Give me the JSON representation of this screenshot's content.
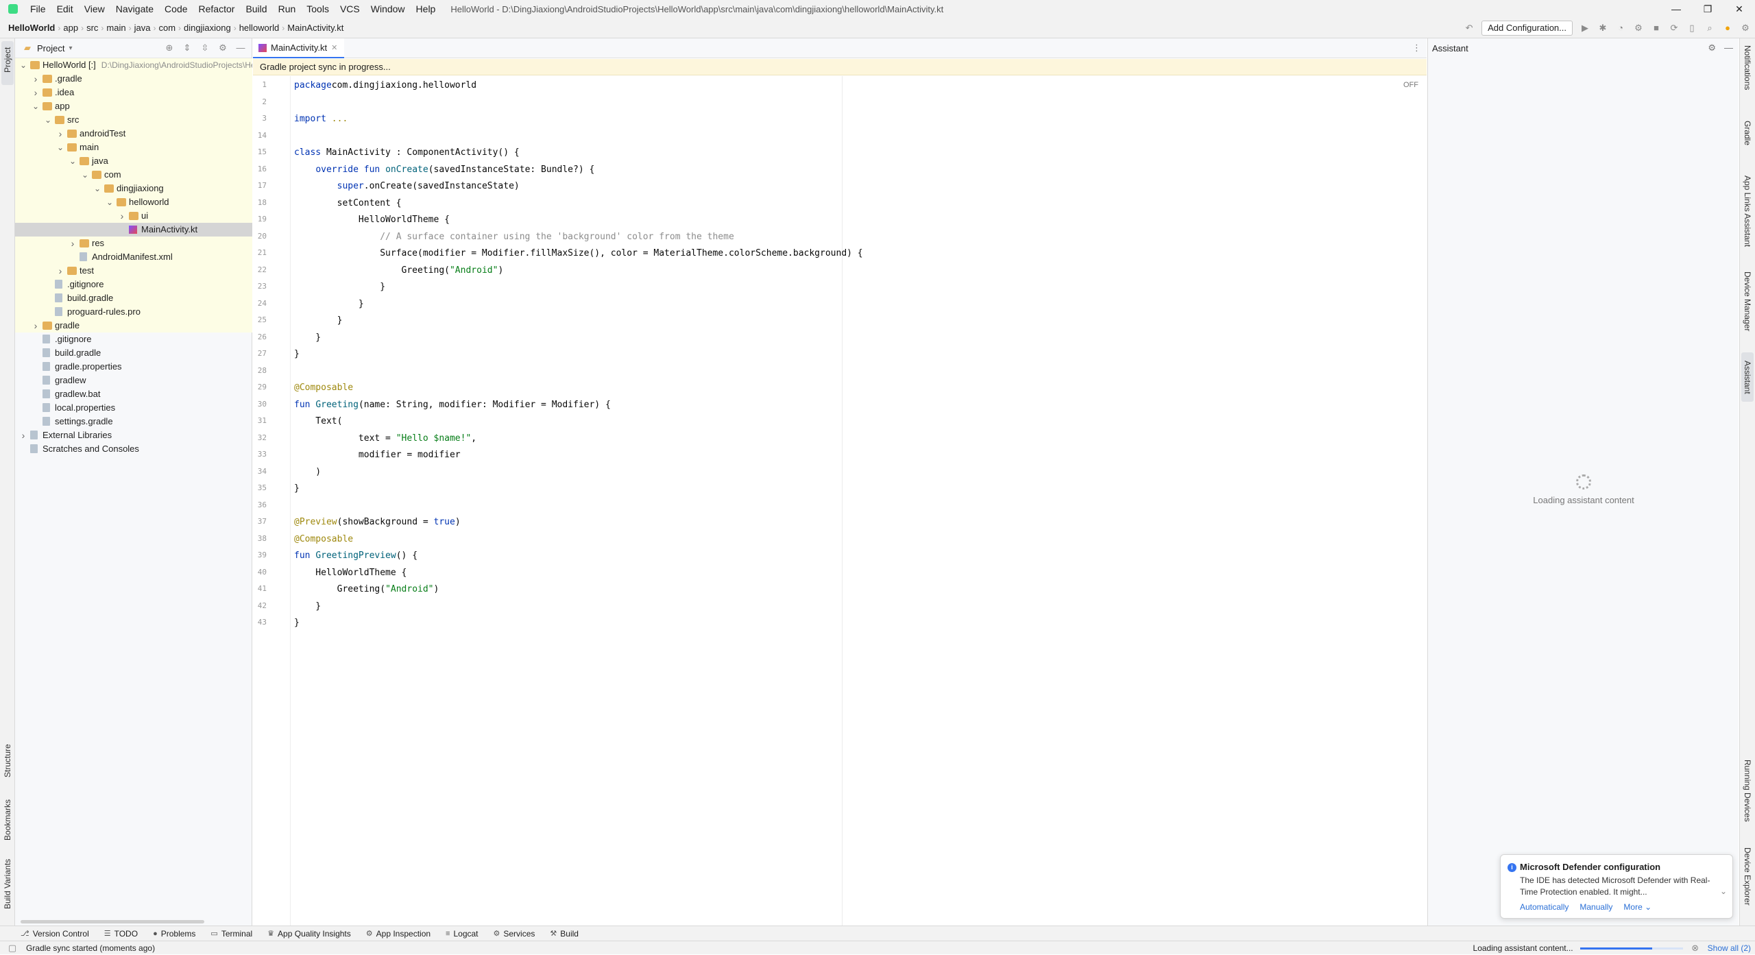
{
  "window": {
    "menu": [
      "File",
      "Edit",
      "View",
      "Navigate",
      "Code",
      "Refactor",
      "Build",
      "Run",
      "Tools",
      "VCS",
      "Window",
      "Help"
    ],
    "title": "HelloWorld - D:\\DingJiaxiong\\AndroidStudioProjects\\HelloWorld\\app\\src\\main\\java\\com\\dingjiaxiong\\helloworld\\MainActivity.kt",
    "controls": [
      "—",
      "❐",
      "✕"
    ]
  },
  "breadcrumb": [
    "HelloWorld",
    "app",
    "src",
    "main",
    "java",
    "com",
    "dingjiaxiong",
    "helloworld",
    "MainActivity.kt"
  ],
  "toolbar": {
    "add_configuration": "Add Configuration..."
  },
  "left_stripe": {
    "project": "Project",
    "structure": "Structure",
    "bookmarks": "Bookmarks",
    "build_variants": "Build Variants"
  },
  "project_panel": {
    "title": "Project",
    "tree": [
      {
        "label": "HelloWorld [:]",
        "hint": "D:\\DingJiaxiong\\AndroidStudioProjects\\HelloWorld",
        "depth": 0,
        "arrow": "v",
        "type": "module",
        "hl": true
      },
      {
        "label": ".gradle",
        "depth": 1,
        "arrow": ">",
        "type": "folder",
        "hl": true
      },
      {
        "label": ".idea",
        "depth": 1,
        "arrow": ">",
        "type": "folder",
        "hl": true
      },
      {
        "label": "app",
        "depth": 1,
        "arrow": "v",
        "type": "folder",
        "hl": true
      },
      {
        "label": "src",
        "depth": 2,
        "arrow": "v",
        "type": "folder",
        "hl": true
      },
      {
        "label": "androidTest",
        "depth": 3,
        "arrow": ">",
        "type": "folder",
        "hl": true
      },
      {
        "label": "main",
        "depth": 3,
        "arrow": "v",
        "type": "folder",
        "hl": true
      },
      {
        "label": "java",
        "depth": 4,
        "arrow": "v",
        "type": "folder",
        "hl": true
      },
      {
        "label": "com",
        "depth": 5,
        "arrow": "v",
        "type": "folder",
        "hl": true
      },
      {
        "label": "dingjiaxiong",
        "depth": 6,
        "arrow": "v",
        "type": "folder",
        "hl": true
      },
      {
        "label": "helloworld",
        "depth": 7,
        "arrow": "v",
        "type": "folder",
        "hl": true
      },
      {
        "label": "ui",
        "depth": 8,
        "arrow": ">",
        "type": "folder",
        "hl": true
      },
      {
        "label": "MainActivity.kt",
        "depth": 8,
        "arrow": "",
        "type": "kt",
        "sel": true
      },
      {
        "label": "res",
        "depth": 4,
        "arrow": ">",
        "type": "folder",
        "hl": true
      },
      {
        "label": "AndroidManifest.xml",
        "depth": 4,
        "arrow": "",
        "type": "file",
        "hl": true
      },
      {
        "label": "test",
        "depth": 3,
        "arrow": ">",
        "type": "folder",
        "hl": true
      },
      {
        "label": ".gitignore",
        "depth": 2,
        "arrow": "",
        "type": "file",
        "hl": true
      },
      {
        "label": "build.gradle",
        "depth": 2,
        "arrow": "",
        "type": "file",
        "hl": true
      },
      {
        "label": "proguard-rules.pro",
        "depth": 2,
        "arrow": "",
        "type": "file",
        "hl": true
      },
      {
        "label": "gradle",
        "depth": 1,
        "arrow": ">",
        "type": "folder",
        "hl": true
      },
      {
        "label": ".gitignore",
        "depth": 1,
        "arrow": "",
        "type": "file"
      },
      {
        "label": "build.gradle",
        "depth": 1,
        "arrow": "",
        "type": "file"
      },
      {
        "label": "gradle.properties",
        "depth": 1,
        "arrow": "",
        "type": "file"
      },
      {
        "label": "gradlew",
        "depth": 1,
        "arrow": "",
        "type": "file"
      },
      {
        "label": "gradlew.bat",
        "depth": 1,
        "arrow": "",
        "type": "file"
      },
      {
        "label": "local.properties",
        "depth": 1,
        "arrow": "",
        "type": "file"
      },
      {
        "label": "settings.gradle",
        "depth": 1,
        "arrow": "",
        "type": "file"
      },
      {
        "label": "External Libraries",
        "depth": 0,
        "arrow": ">",
        "type": "lib"
      },
      {
        "label": "Scratches and Consoles",
        "depth": 0,
        "arrow": "",
        "type": "lib"
      }
    ]
  },
  "editor": {
    "tab_label": "MainActivity.kt",
    "sync_banner": "Gradle project sync in progress...",
    "off_label": "OFF",
    "lines": [
      {
        "n": "1",
        "segs": [
          [
            "kw",
            "package"
          ],
          [
            "",
            "com.dingjiaxiong.helloworld"
          ]
        ]
      },
      {
        "n": "2",
        "segs": []
      },
      {
        "n": "3",
        "segs": [
          [
            "kw",
            "import"
          ],
          [
            "",
            " "
          ],
          [
            "ann",
            "..."
          ]
        ]
      },
      {
        "n": "14",
        "segs": []
      },
      {
        "n": "15",
        "segs": [
          [
            "kw",
            "class"
          ],
          [
            "",
            " MainActivity : ComponentActivity() {"
          ]
        ]
      },
      {
        "n": "16",
        "segs": [
          [
            "",
            "    "
          ],
          [
            "kw",
            "override fun"
          ],
          [
            "",
            " "
          ],
          [
            "fn",
            "onCreate"
          ],
          [
            "",
            "(savedInstanceState: Bundle?) {"
          ]
        ]
      },
      {
        "n": "17",
        "segs": [
          [
            "",
            "        "
          ],
          [
            "kw",
            "super"
          ],
          [
            "",
            ".onCreate(savedInstanceState)"
          ]
        ]
      },
      {
        "n": "18",
        "segs": [
          [
            "",
            "        setContent {"
          ]
        ]
      },
      {
        "n": "19",
        "segs": [
          [
            "",
            "            HelloWorldTheme {"
          ]
        ]
      },
      {
        "n": "20",
        "segs": [
          [
            "cmt",
            "                // A surface container using the 'background' color from the theme"
          ]
        ]
      },
      {
        "n": "21",
        "segs": [
          [
            "",
            "                Surface(modifier = Modifier.fillMaxSize(), color = MaterialTheme.colorScheme.background) {"
          ]
        ]
      },
      {
        "n": "22",
        "segs": [
          [
            "",
            "                    Greeting("
          ],
          [
            "str",
            "\"Android\""
          ],
          [
            "",
            ")"
          ]
        ]
      },
      {
        "n": "23",
        "segs": [
          [
            "",
            "                }"
          ]
        ]
      },
      {
        "n": "24",
        "segs": [
          [
            "",
            "            }"
          ]
        ]
      },
      {
        "n": "25",
        "segs": [
          [
            "",
            "        }"
          ]
        ]
      },
      {
        "n": "26",
        "segs": [
          [
            "",
            "    }"
          ]
        ]
      },
      {
        "n": "27",
        "segs": [
          [
            "",
            "}"
          ]
        ]
      },
      {
        "n": "28",
        "segs": []
      },
      {
        "n": "29",
        "segs": [
          [
            "ann",
            "@Composable"
          ]
        ]
      },
      {
        "n": "30",
        "segs": [
          [
            "kw",
            "fun"
          ],
          [
            "",
            " "
          ],
          [
            "fn",
            "Greeting"
          ],
          [
            "",
            "(name: String, modifier: Modifier = Modifier) {"
          ]
        ]
      },
      {
        "n": "31",
        "segs": [
          [
            "",
            "    Text("
          ]
        ]
      },
      {
        "n": "32",
        "segs": [
          [
            "",
            "            text = "
          ],
          [
            "str",
            "\"Hello $name!\""
          ],
          [
            "",
            ","
          ]
        ]
      },
      {
        "n": "33",
        "segs": [
          [
            "",
            "            modifier = modifier"
          ]
        ]
      },
      {
        "n": "34",
        "segs": [
          [
            "",
            "    )"
          ]
        ]
      },
      {
        "n": "35",
        "segs": [
          [
            "",
            "}"
          ]
        ]
      },
      {
        "n": "36",
        "segs": []
      },
      {
        "n": "37",
        "segs": [
          [
            "ann",
            "@Preview"
          ],
          [
            "",
            "(showBackground = "
          ],
          [
            "kw",
            "true"
          ],
          [
            "",
            ")"
          ]
        ]
      },
      {
        "n": "38",
        "segs": [
          [
            "ann",
            "@Composable"
          ]
        ]
      },
      {
        "n": "39",
        "segs": [
          [
            "kw",
            "fun"
          ],
          [
            "",
            " "
          ],
          [
            "fn",
            "GreetingPreview"
          ],
          [
            "",
            "() {"
          ]
        ]
      },
      {
        "n": "40",
        "segs": [
          [
            "",
            "    HelloWorldTheme {"
          ]
        ]
      },
      {
        "n": "41",
        "segs": [
          [
            "",
            "        Greeting("
          ],
          [
            "str",
            "\"Android\""
          ],
          [
            "",
            ")"
          ]
        ]
      },
      {
        "n": "42",
        "segs": [
          [
            "",
            "    }"
          ]
        ]
      },
      {
        "n": "43",
        "segs": [
          [
            "",
            "}"
          ]
        ]
      }
    ]
  },
  "assistant": {
    "title": "Assistant",
    "loading": "Loading assistant content"
  },
  "right_stripe": [
    "Notifications",
    "Gradle",
    "App Links Assistant",
    "Device Manager",
    "Assistant",
    "Running Devices",
    "Device Explorer"
  ],
  "notification": {
    "title": "Microsoft Defender configuration",
    "body": "The IDE has detected Microsoft Defender with Real-Time Protection enabled. It might...",
    "actions": [
      "Automatically",
      "Manually",
      "More ⌄"
    ]
  },
  "bottom_tools": [
    {
      "icon": "⎇",
      "label": "Version Control"
    },
    {
      "icon": "☰",
      "label": "TODO"
    },
    {
      "icon": "●",
      "label": "Problems"
    },
    {
      "icon": "▭",
      "label": "Terminal"
    },
    {
      "icon": "♛",
      "label": "App Quality Insights"
    },
    {
      "icon": "⚙",
      "label": "App Inspection"
    },
    {
      "icon": "≡",
      "label": "Logcat"
    },
    {
      "icon": "⚙",
      "label": "Services"
    },
    {
      "icon": "⚒",
      "label": "Build"
    }
  ],
  "status": {
    "left": "Gradle sync started (moments ago)",
    "right": "Loading assistant content...",
    "show_all": "Show all (2)"
  }
}
